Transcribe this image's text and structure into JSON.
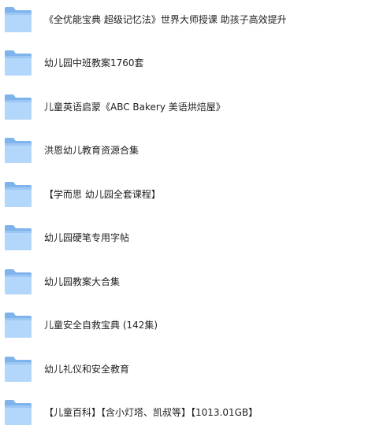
{
  "folder_colors": {
    "back": "#7eb3ec",
    "front": "#b3d7fa",
    "front_edge": "#9cc6f4"
  },
  "items": [
    {
      "icon": "folder-icon",
      "name": "《全优能宝典 超级记忆法》世界大师授课 助孩子高效提升"
    },
    {
      "icon": "folder-icon",
      "name": "幼儿园中班教案1760套"
    },
    {
      "icon": "folder-icon",
      "name": "儿童英语启蒙《ABC Bakery 美语烘焙屋》"
    },
    {
      "icon": "folder-icon",
      "name": "洪恩幼儿教育资源合集"
    },
    {
      "icon": "folder-icon",
      "name": "【学而思 幼儿园全套课程】"
    },
    {
      "icon": "folder-icon",
      "name": "幼儿园硬笔专用字帖"
    },
    {
      "icon": "folder-icon",
      "name": "幼儿园教案大合集"
    },
    {
      "icon": "folder-icon",
      "name": "儿童安全自救宝典 (142集)"
    },
    {
      "icon": "folder-icon",
      "name": "幼儿礼仪和安全教育"
    },
    {
      "icon": "folder-icon",
      "name": "【儿童百科】【含小灯塔、凯叔等】【1013.01GB】"
    }
  ]
}
